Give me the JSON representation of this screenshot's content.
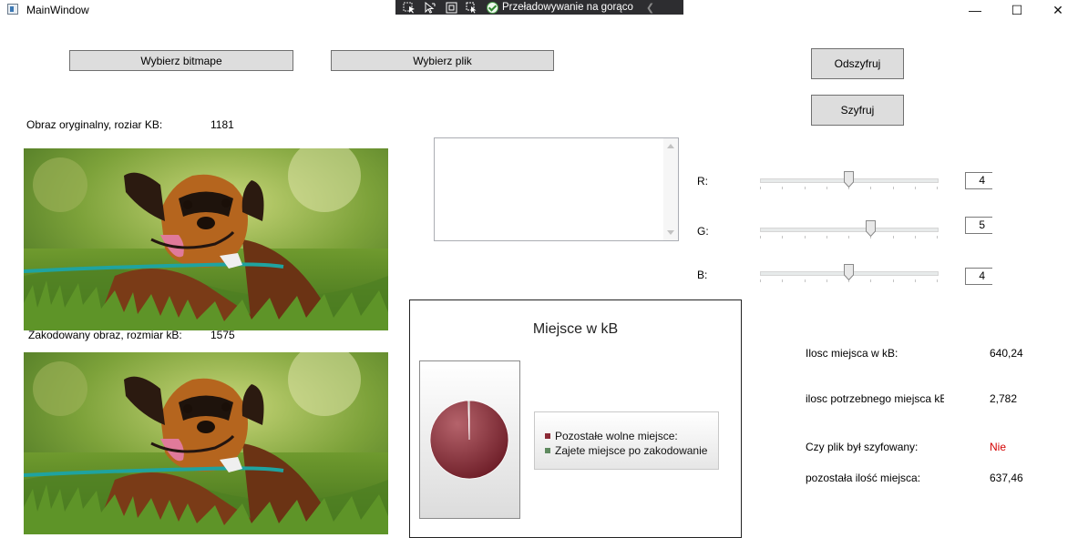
{
  "window": {
    "title": "MainWindow",
    "controls": {
      "minimize": "—",
      "maximize": "☐",
      "close": "✕"
    }
  },
  "debug_toolbar": {
    "hot_reload_label": "Przeładowywanie na gorąco",
    "icons": [
      "select-element-icon",
      "pointer-icon",
      "display-layout-icon",
      "track-focus-icon"
    ]
  },
  "buttons": {
    "choose_bitmap": "Wybierz bitmape",
    "choose_file": "Wybierz plik",
    "decrypt": "Odszyfruj",
    "encrypt": "Szyfruj"
  },
  "original_image": {
    "label": "Obraz oryginalny, roziar KB:",
    "size": "1181"
  },
  "encoded_image": {
    "label": "Zakodowany obraz, rozmiar kB:",
    "size": "1575"
  },
  "message_text": "",
  "sliders": [
    {
      "label": "R:",
      "value": "4",
      "max": 8
    },
    {
      "label": "G:",
      "value": "5",
      "max": 8
    },
    {
      "label": "B:",
      "value": "4",
      "max": 8
    }
  ],
  "chart_data": {
    "type": "pie",
    "title": "Miejsce w kB",
    "series": [
      {
        "name": "Pozostałe wolne miejsce:",
        "value": 637.46,
        "color": "#8b2a36"
      },
      {
        "name": "Zajete miejsce po zakodowanie",
        "value": 2.782,
        "color": "#5f8a5f"
      }
    ]
  },
  "info": {
    "space_label": "Ilosc miejsca w kB:",
    "space_value": "640,24",
    "needed_label": "ilosc potrzebnego miejsca kE",
    "needed_value": "2,782",
    "encrypted_label": "Czy plik był szyfowany:",
    "encrypted_value": "Nie",
    "remaining_label": "pozostała ilość miejsca:",
    "remaining_value": "637,46"
  },
  "colors": {
    "encrypted_no": "#d40000",
    "button_bg": "#dddddd",
    "debug_bar": "#2d2d30"
  }
}
